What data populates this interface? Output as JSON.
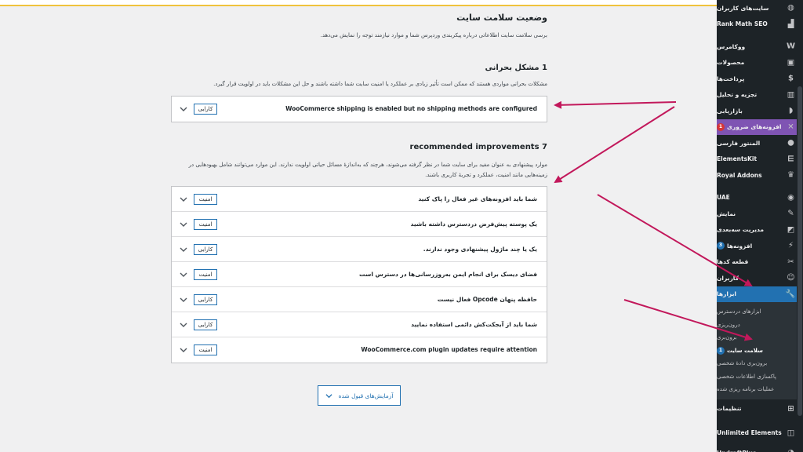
{
  "page": {
    "title": "وضعیت سلامت سایت",
    "description": "برسی سلامت سایت اطلاعاتی درباره پیکربندی وردپرس شما و موارد نیازمند توجه را نمایش می‌دهد."
  },
  "critical": {
    "title": "1 مشکل بحرانی",
    "description": "مشکلات بحرانی مواردی هستند که ممکن است تأثیر زیادی بر عملکرد یا امنیت سایت شما داشته باشند و حل این مشکلات باید در اولویت قرار گیرد.",
    "issues": [
      {
        "label": "WooCommerce shipping is enabled but no shipping methods are configured",
        "badge": "کارایی"
      }
    ]
  },
  "recommended": {
    "title": "7 recommended improvements",
    "description": "موارد پیشنهادی به عنوان مفید برای سایت شما در نظر گرفته می‌شوند، هرچند که به‌اندازهٔ مسائل حیاتی اولویت ندارند. این موارد می‌توانند شامل بهبودهایی در زمینه‌هایی مانند امنیت، عملکرد و تجربهٔ کاربری باشند.",
    "issues": [
      {
        "label": "شما باید افزونه‌های غیر فعال را پاک کنید",
        "badge": "امنیت"
      },
      {
        "label": "یک پوسته پیش‌فرض دردسترس داشته باشید",
        "badge": "امنیت"
      },
      {
        "label": "یک یا چند ماژول پیشنهادی وجود ندارند.",
        "badge": "کارایی"
      },
      {
        "label": "فضای دیسک برای انجام ایمن به‌روزرسانی‌ها در دسترس است",
        "badge": "امنیت"
      },
      {
        "label": "حافظه پنهان Opcode فعال نیست",
        "badge": "کارایی"
      },
      {
        "label": "شما باید از آبجکت‌کش دائمی استفاده نمایید",
        "badge": "کارایی"
      },
      {
        "label": "WooCommerce.com plugin updates require attention",
        "badge": "امنیت"
      }
    ]
  },
  "passed_button": "آزمایش‌های قبول شده",
  "sidebar": {
    "items": [
      {
        "label": "سایت‌های کاربران",
        "icon": "globe-icon",
        "glyph": "◍"
      },
      {
        "label": "Rank Math SEO",
        "icon": "rankmath-icon",
        "glyph": "▟"
      },
      {
        "label": "ووکامرس",
        "icon": "woocommerce-icon",
        "glyph": "W"
      },
      {
        "label": "محصولات",
        "icon": "products-icon",
        "glyph": "▣"
      },
      {
        "label": "پرداخت‌ها",
        "icon": "payments-icon",
        "glyph": "$"
      },
      {
        "label": "تجزیه و تحلیل",
        "icon": "analytics-icon",
        "glyph": "▥"
      },
      {
        "label": "بازاریابی",
        "icon": "marketing-icon",
        "glyph": "◗"
      },
      {
        "label": "افزونه‌های ضروری",
        "icon": "essential-addons-icon",
        "glyph": "✕",
        "count": "1"
      },
      {
        "label": "المنتور فارسی",
        "icon": "elementor-fa-icon",
        "glyph": "●"
      },
      {
        "label": "ElementsKit",
        "icon": "elementskit-icon",
        "glyph": "⋿"
      },
      {
        "label": "Royal Addons",
        "icon": "royal-addons-icon",
        "glyph": "♛"
      },
      {
        "label": "UAE",
        "icon": "uae-icon",
        "glyph": "◉"
      },
      {
        "label": "نمایش",
        "icon": "appearance-icon",
        "glyph": "✎"
      },
      {
        "label": "مدیریت سه‌بعدی",
        "icon": "3d-icon",
        "glyph": "◩"
      },
      {
        "label": "افزونه‌ها",
        "icon": "plugins-icon",
        "glyph": "⚡",
        "count": "3"
      },
      {
        "label": "قطعه کدها",
        "icon": "snippets-icon",
        "glyph": "✂"
      },
      {
        "label": "کاربران",
        "icon": "users-icon",
        "glyph": "☺"
      },
      {
        "label": "ابزارها",
        "icon": "tools-icon",
        "glyph": "🔧"
      }
    ],
    "submenu": [
      {
        "label": "ابزارهای دردسترس"
      },
      {
        "label": "درون‌ریزی"
      },
      {
        "label": "برون‌بری"
      },
      {
        "label": "سلامت سایت",
        "count": "1"
      },
      {
        "label": "برون‌بری دادهٔ شخصی"
      },
      {
        "label": "پاکسازی اطلاعات شخصی"
      },
      {
        "label": "عملیات برنامه ریزی شده"
      }
    ],
    "after": [
      {
        "label": "تنظیمات",
        "icon": "settings-icon",
        "glyph": "⊞"
      },
      {
        "label": "Unlimited Elements",
        "icon": "unlimited-elements-icon",
        "glyph": "◫"
      },
      {
        "label": "UpdraftPlus",
        "icon": "updraftplus-icon",
        "glyph": "◔"
      }
    ]
  },
  "colors": {
    "admin_dark": "#1d2327",
    "accent_blue": "#2271b1",
    "woo_purple": "#7f54b3",
    "arrow_red": "#c2185b"
  }
}
